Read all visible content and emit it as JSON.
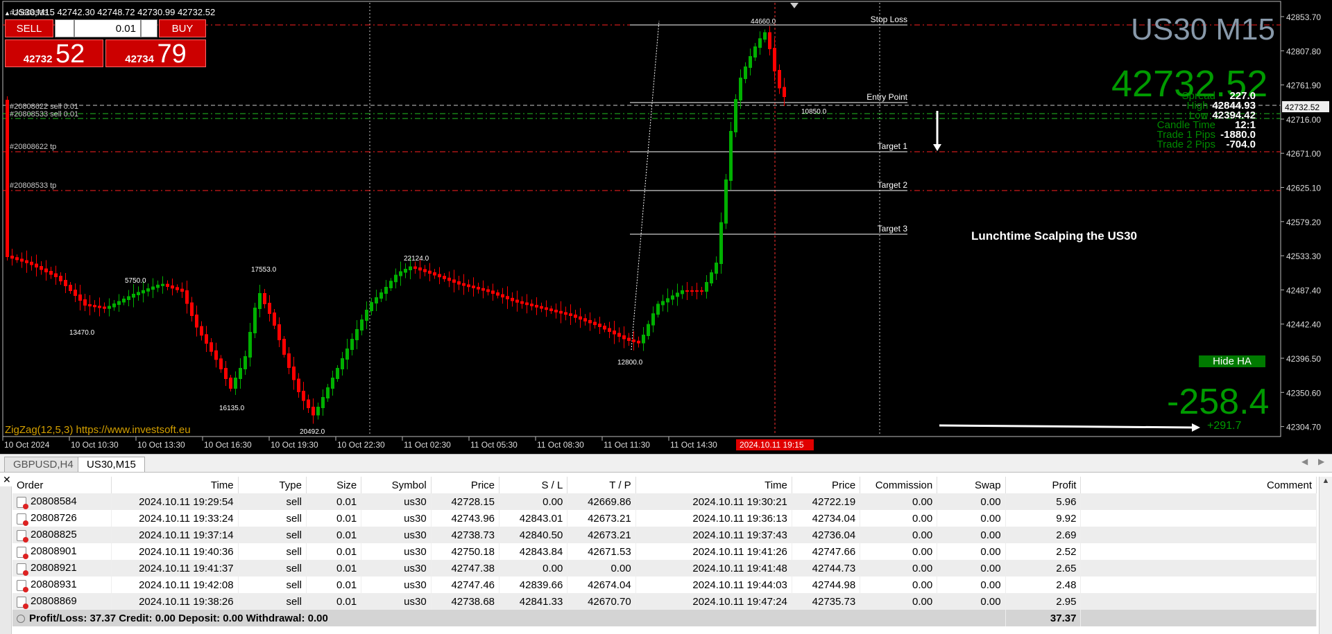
{
  "chart": {
    "header": "US30,M15  42742.30 42748.72 42730.99 42732.52",
    "header_cut": "#20808533...",
    "symbol_title": "US30 M15",
    "big_bid": "42732.52",
    "info": [
      {
        "label": "Spread",
        "value": "227.0"
      },
      {
        "label": "High",
        "value": "42844.93"
      },
      {
        "label": "Low",
        "value": "42394.42"
      },
      {
        "label": "Candle Time",
        "value": "12:1"
      },
      {
        "label": "Trade 1 Pips",
        "value": "-1880.0"
      },
      {
        "label": "Trade 2 Pips",
        "value": "-704.0"
      }
    ],
    "hide_ha_label": "Hide HA",
    "pl_big": "-258.4",
    "pl_small": "+291.7",
    "zigzag_text": "ZigZag(12,5,3) ",
    "zigzag_link": "https://www.investsoft.eu",
    "annotation": "Lunchtime Scalping the US30",
    "levels": {
      "stop_loss": "Stop Loss",
      "entry": "Entry Point",
      "t1": "Target 1",
      "t2": "Target 2",
      "t3": "Target 3"
    },
    "order_lines": {
      "sell1": "#20808622 sell 0.01",
      "sell2": "#20808533 sell 0.01",
      "tp1": "#20808622 tp",
      "tp2": "#20808533 tp"
    },
    "zigzag_labels": [
      "5750.0",
      "13470.0",
      "17553.0",
      "16135.0",
      "20492.0",
      "22124.0",
      "12800.0",
      "44660.0",
      "10850.0"
    ],
    "price_ticks": [
      "42853.70",
      "42807.80",
      "42761.90",
      "42716.00",
      "42671.00",
      "42625.10",
      "42579.20",
      "42533.30",
      "42487.40",
      "42442.40",
      "42396.50",
      "42350.60",
      "42304.70"
    ],
    "current_price_tag": "42732.52",
    "time_ticks": [
      "10 Oct 2024",
      "10 Oct 10:30",
      "10 Oct 13:30",
      "10 Oct 16:30",
      "10 Oct 19:30",
      "10 Oct 22:30",
      "11 Oct 02:30",
      "11 Oct 05:30",
      "11 Oct 08:30",
      "11 Oct 11:30",
      "11 Oct 14:30"
    ],
    "time_highlight": "2024.10.11 19:15",
    "colors": {
      "bull": "#00b000",
      "bear": "#ff0000",
      "green_text": "#008a00",
      "title_gray": "#8899aa"
    }
  },
  "trade_panel": {
    "sell_label": "SELL",
    "buy_label": "BUY",
    "lot": "0.01",
    "bid_small": "42732",
    "bid_big": "52",
    "ask_small": "42734",
    "ask_big": "79"
  },
  "tabs": [
    "GBPUSD,H4",
    "US30,M15"
  ],
  "terminal": {
    "columns": [
      "Order",
      "Time",
      "Type",
      "Size",
      "Symbol",
      "Price",
      "S / L",
      "T / P",
      "Time",
      "Price",
      "Commission",
      "Swap",
      "Profit",
      "Comment"
    ],
    "rows": [
      [
        "20808584",
        "2024.10.11 19:29:54",
        "sell",
        "0.01",
        "us30",
        "42728.15",
        "0.00",
        "42669.86",
        "2024.10.11 19:30:21",
        "42722.19",
        "0.00",
        "0.00",
        "5.96"
      ],
      [
        "20808726",
        "2024.10.11 19:33:24",
        "sell",
        "0.01",
        "us30",
        "42743.96",
        "42843.01",
        "42673.21",
        "2024.10.11 19:36:13",
        "42734.04",
        "0.00",
        "0.00",
        "9.92"
      ],
      [
        "20808825",
        "2024.10.11 19:37:14",
        "sell",
        "0.01",
        "us30",
        "42738.73",
        "42840.50",
        "42673.21",
        "2024.10.11 19:37:43",
        "42736.04",
        "0.00",
        "0.00",
        "2.69"
      ],
      [
        "20808901",
        "2024.10.11 19:40:36",
        "sell",
        "0.01",
        "us30",
        "42750.18",
        "42843.84",
        "42671.53",
        "2024.10.11 19:41:26",
        "42747.66",
        "0.00",
        "0.00",
        "2.52"
      ],
      [
        "20808921",
        "2024.10.11 19:41:37",
        "sell",
        "0.01",
        "us30",
        "42747.38",
        "0.00",
        "0.00",
        "2024.10.11 19:41:48",
        "42744.73",
        "0.00",
        "0.00",
        "2.65"
      ],
      [
        "20808931",
        "2024.10.11 19:42:08",
        "sell",
        "0.01",
        "us30",
        "42747.46",
        "42839.66",
        "42674.04",
        "2024.10.11 19:44:03",
        "42744.98",
        "0.00",
        "0.00",
        "2.48"
      ],
      [
        "20808869",
        "2024.10.11 19:38:26",
        "sell",
        "0.01",
        "us30",
        "42738.68",
        "42841.33",
        "42670.70",
        "2024.10.11 19:47:24",
        "42735.73",
        "0.00",
        "0.00",
        "2.95"
      ]
    ],
    "summary": "Profit/Loss: 37.37  Credit: 0.00  Deposit: 0.00  Withdrawal: 0.00",
    "summary_total": "37.37"
  }
}
